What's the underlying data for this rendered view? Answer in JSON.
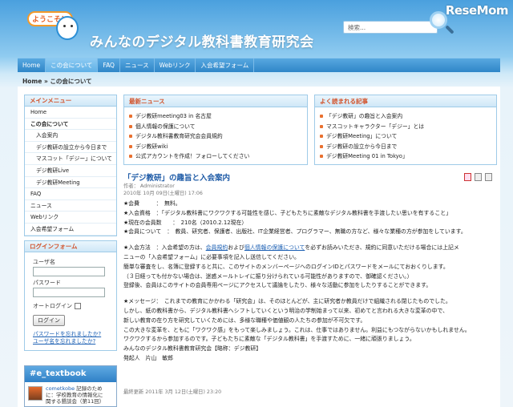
{
  "watermark": "ReseMom",
  "header": {
    "badge_text": "ようこそ！",
    "site_title": "みんなのデジタル教科書教育研究会",
    "search_placeholder": "検索..."
  },
  "nav": {
    "tabs": [
      {
        "label": "Home"
      },
      {
        "label": "この会について"
      },
      {
        "label": "FAQ"
      },
      {
        "label": "ニュース"
      },
      {
        "label": "Webリンク"
      },
      {
        "label": "入会希望フォーム"
      }
    ],
    "active": "この会について"
  },
  "breadcrumb": "Home » この会について",
  "sidebar": {
    "main_menu_title": "メインメニュー",
    "menu_items": [
      {
        "label": "Home",
        "level": 0
      },
      {
        "label": "この会について",
        "level": 0
      },
      {
        "label": "入会案内",
        "level": 1
      },
      {
        "label": "デジ教研の設立から今日まで",
        "level": 1
      },
      {
        "label": "マスコット「デジー」について",
        "level": 1
      },
      {
        "label": "デジ教研Live",
        "level": 1
      },
      {
        "label": "デジ教研Meeting",
        "level": 1
      },
      {
        "label": "FAQ",
        "level": 0
      },
      {
        "label": "ニュース",
        "level": 0
      },
      {
        "label": "Webリンク",
        "level": 0
      },
      {
        "label": "入会希望フォーム",
        "level": 0
      }
    ],
    "login": {
      "title": "ログインフォーム",
      "username_label": "ユーザ名",
      "password_label": "パスワード",
      "auto_login_label": "オートログイン",
      "login_button": "ログイン",
      "forgot_password": "パスワードを忘れましたか?",
      "forgot_username": "ユーザ名を忘れましたか?"
    },
    "twitter": {
      "title": "#e_textbook",
      "user": "cometkobe",
      "text_line1": "記録のため",
      "text_line2": "に：学校教育の情報化に",
      "text_line3": "関する懇談会（第11回）"
    }
  },
  "latest_news": {
    "title": "最新ニュース",
    "items": [
      "デジ教研meeting03 in 名古屋",
      "個人情報の保護について",
      "デジタル教科書教育研究会会員規約",
      "デジ教研wiki",
      "公式アカウントを作成！フォローしてください"
    ]
  },
  "popular": {
    "title": "よく読まれる記事",
    "items": [
      "「デジ教研」の趣旨と入会案内",
      "マスコットキャラクター「デジー」とは",
      "デジ教研Meeting」について",
      "デジ教研の設立から今日まで",
      "デジ教研Meeting 01 in Tokyo」"
    ]
  },
  "article": {
    "title": "「デジ教研」の趣旨と入会案内",
    "author": "作者： Administrator",
    "date": "2010年 10月 09日(土曜日) 17:06",
    "lines": [
      "★会費　　　：　無料。",
      "★入会資格　：「デジタル教科書にワクワクする可能性を感じ、子どもたちに素敵なデジタル教科書を手渡したい思いを有すること」",
      "★現在の会員数　　：　210名（2010.2.12現在）",
      "★会員について　：　教員、研究者、保護者、出版社、IT企業経営者、プログラマー、無職の方など、様々な業種の方が参加をしています。"
    ],
    "apply_prefix": "★入会方法　：入会希望の方は、",
    "apply_link1": "会員規約",
    "apply_mid1": "および",
    "apply_link2": "個人情報の保護について",
    "apply_suffix": "を必ずお読みいただき、規約に同意いただける場合には上記メ",
    "lines2": [
      "ニューの「入会希望フォーム」に必要事項を記入し送信してください。",
      "簡単な審査をし、名簿に登録すると共に、このサイトのメンバーページへのログインIDとパスワードをメールにておおくりします。",
      "（３日経っても付かない場合は、迷惑メールトレイに振り分けられている可能性がありますので、御確認ください。）",
      "登録後、会員はこのサイトの会員専用ページにアクセスして議論をしたり、様々な活動に参加をしたりすることができます。"
    ],
    "lines3": [
      "★メッセージ：　これまでの教育にかかわる「研究会」は、そのほとんどが、主に研究者か教員だけで組織される閉じたものでした。",
      "しかし、紙の教科書から、デジタル教科書へシフトしていくという明治の学制始まって以来、初めてと言われる大きな変革の中で、",
      "新しい教育の在り方を研究していくためには、多様な職種や価値観の人たちの参加が不可欠です。",
      "この大きな変革を、ともに「ワクワク感」をもって楽しみましょう。これは、仕事ではありません。利益にもつながらないかもしれません。",
      "ワクワクするから参加するのです。子どもたちに素敵な「デジタル教科書」を手渡すために、一緒に頑張りましょう。",
      "みんなのデジタル教科書教育研究会【略称：デジ教研】",
      "発起人　片山　敏郎"
    ],
    "updated": "最終更新 2011年 3月 12日(土曜日) 23:20"
  },
  "colors": {
    "accent": "#d2522a",
    "link": "#1b5fb3",
    "nav": "#2f86c8"
  }
}
